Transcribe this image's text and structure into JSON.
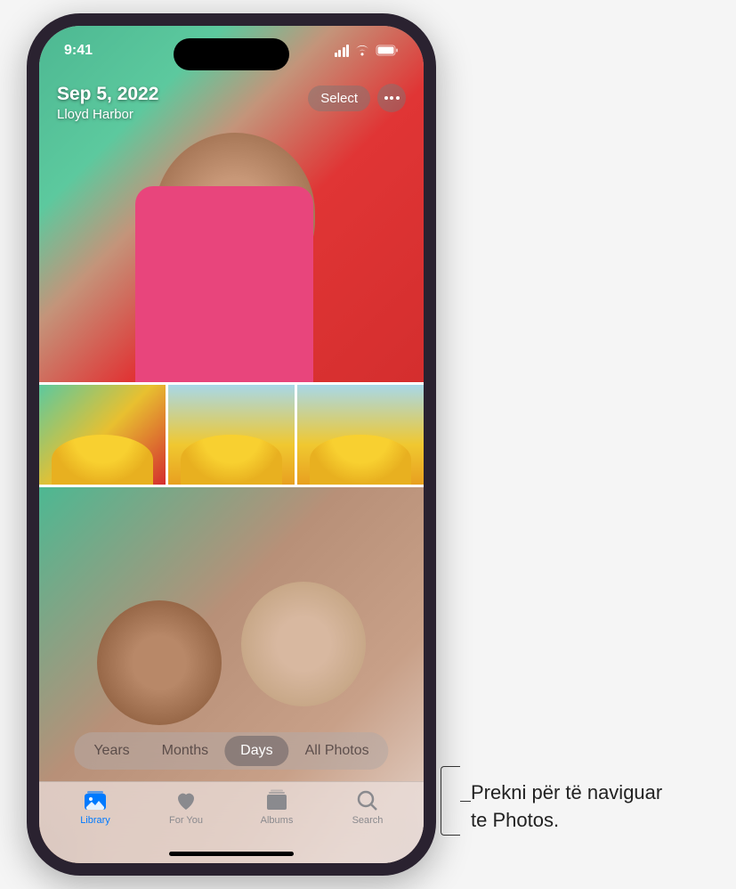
{
  "status": {
    "time": "9:41"
  },
  "header": {
    "date": "Sep 5, 2022",
    "location": "Lloyd Harbor",
    "select_label": "Select"
  },
  "view_switcher": {
    "tabs": [
      {
        "label": "Years",
        "active": false
      },
      {
        "label": "Months",
        "active": false
      },
      {
        "label": "Days",
        "active": true
      },
      {
        "label": "All Photos",
        "active": false
      }
    ]
  },
  "tab_bar": {
    "items": [
      {
        "label": "Library",
        "active": true
      },
      {
        "label": "For You",
        "active": false
      },
      {
        "label": "Albums",
        "active": false
      },
      {
        "label": "Search",
        "active": false
      }
    ]
  },
  "callout": {
    "line1": "Prekni për të naviguar",
    "line2": "te Photos."
  },
  "colors": {
    "accent": "#007aff"
  }
}
